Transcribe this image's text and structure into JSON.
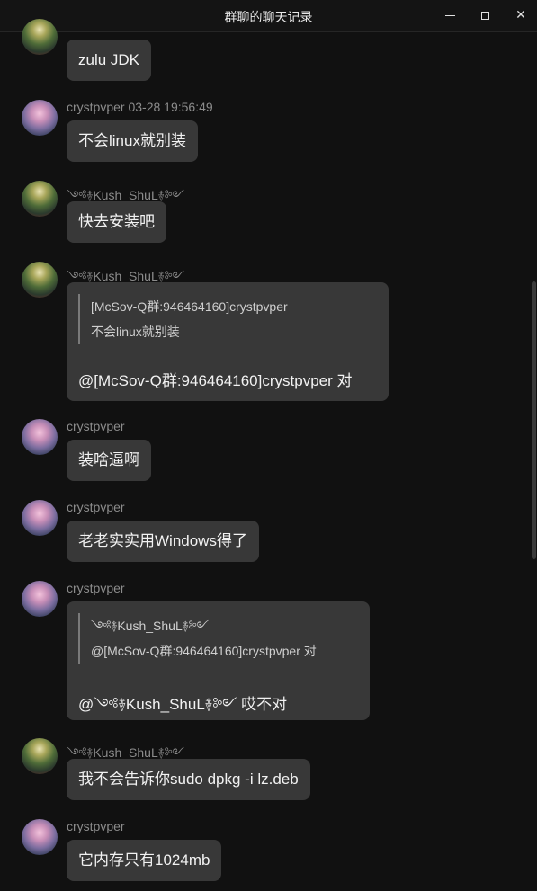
{
  "window": {
    "title": "群聊的聊天记录",
    "controls": [
      "minimize-icon",
      "maximize-icon",
      "close-icon"
    ],
    "close_glyph": "✕"
  },
  "messages": [
    {
      "sender": "",
      "avatar": "kush",
      "text": "zulu JDK"
    },
    {
      "sender": "crystpvper 03-28 19:56:49",
      "avatar": "crystpvper",
      "text": "不会linux就别装"
    },
    {
      "sender": "༺࿈Kush_ShuL࿈༻",
      "avatar": "kush",
      "text": "快去安装吧"
    },
    {
      "sender": "༺࿈Kush_ShuL࿈༻",
      "avatar": "kush",
      "quote": {
        "line1": "[McSov-Q群:946464160]crystpvper",
        "line2": "不会linux就别装"
      },
      "text": "@[McSov-Q群:946464160]crystpvper 对"
    },
    {
      "sender": "crystpvper",
      "avatar": "crystpvper",
      "text": "装啥逼啊"
    },
    {
      "sender": "crystpvper",
      "avatar": "crystpvper",
      "text": "老老实实用Windows得了"
    },
    {
      "sender": "crystpvper",
      "avatar": "crystpvper",
      "quote": {
        "line1": "༺࿈Kush_ShuL࿈༻",
        "line2": "@[McSov-Q群:946464160]crystpvper 对"
      },
      "text": "@༺࿈Kush_ShuL࿈༻ 哎不对"
    },
    {
      "sender": "༺࿈Kush_ShuL࿈༻",
      "avatar": "kush",
      "text": "我不会告诉你sudo dpkg -i lz.deb"
    },
    {
      "sender": "crystpvper",
      "avatar": "crystpvper",
      "text": "它内存只有1024mb"
    }
  ]
}
